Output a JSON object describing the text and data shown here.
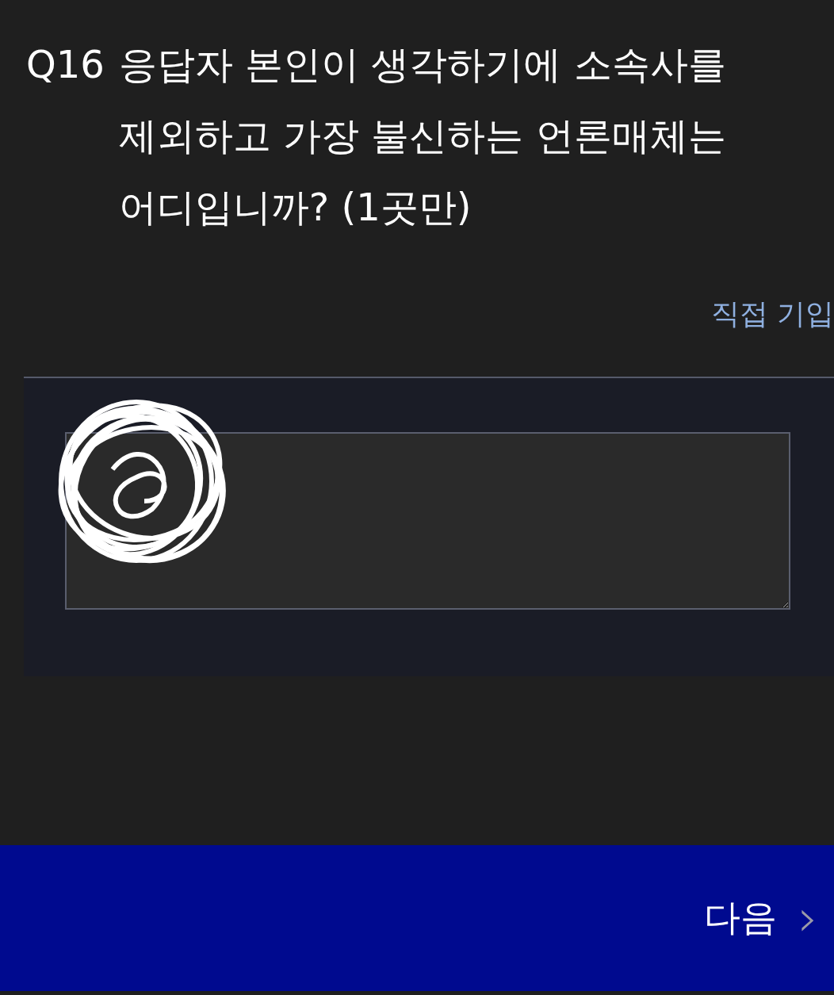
{
  "question": {
    "number": "Q16",
    "text": "응답자 본인이 생각하기에 소속사를 제외하고 가장 불신하는 언론매체는 어디입니까? (1곳만)"
  },
  "direct_input_label": "직접 기입",
  "next_button": {
    "label": "다음",
    "icon": "›"
  }
}
